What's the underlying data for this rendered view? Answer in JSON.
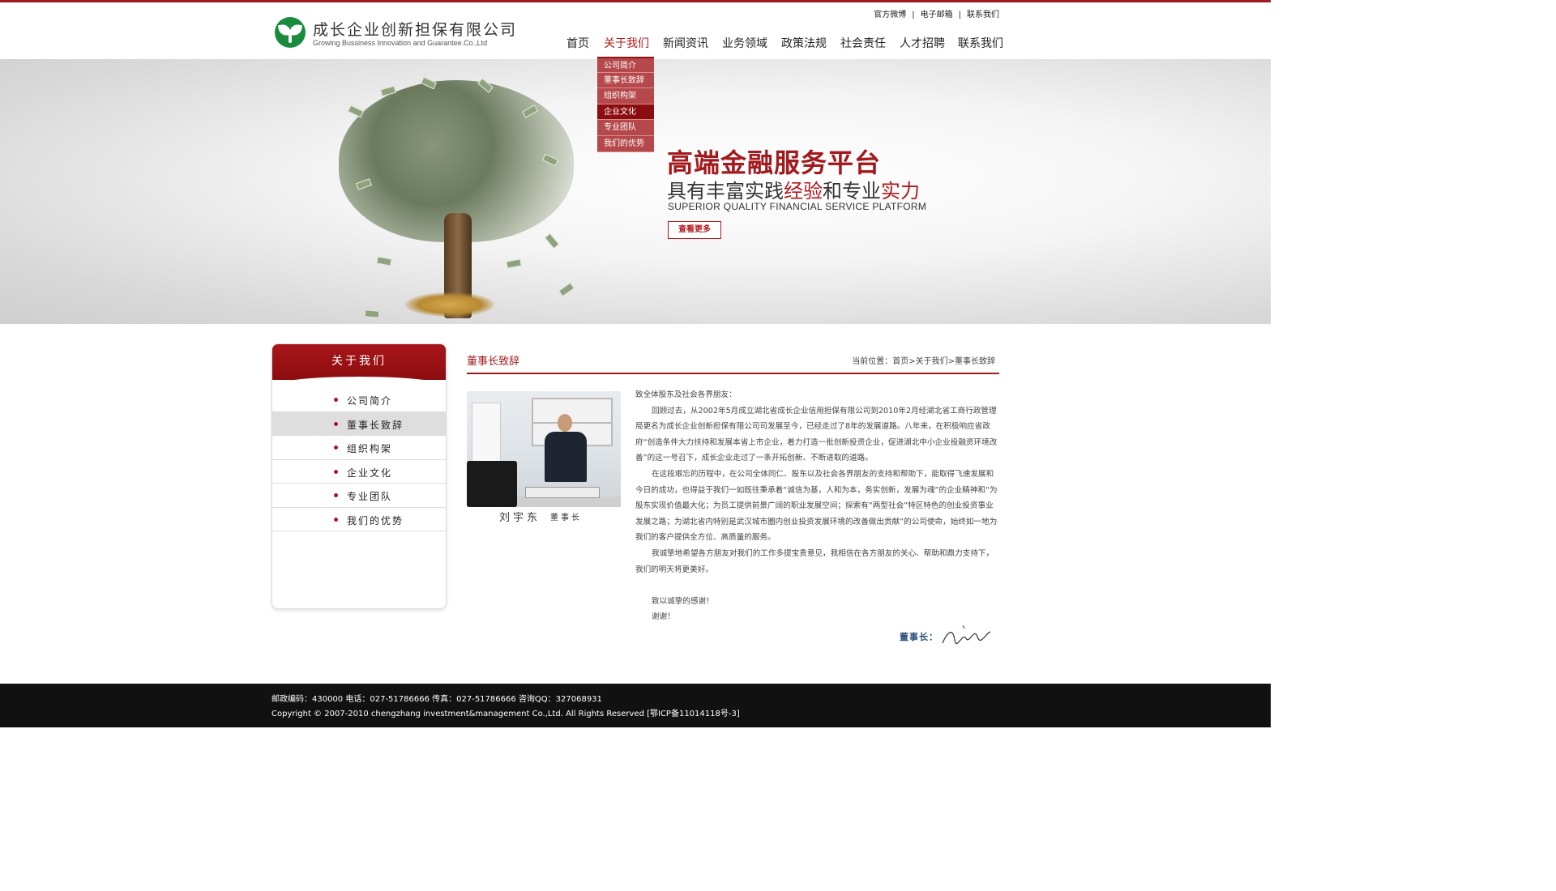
{
  "colors": {
    "accent": "#9b1b1e",
    "brand_green": "#1a8b3d",
    "footer_bg": "#111111"
  },
  "header": {
    "logo_cn": "成长企业创新担保有限公司",
    "logo_en": "Growing Bussiness Innovation and  Guarantee.Co.,Ltd",
    "logo_icon": "leaf-logo-icon",
    "top_links": [
      "官方微博",
      "电子邮箱",
      "联系我们"
    ],
    "nav": [
      "首页",
      "关于我们",
      "新闻资讯",
      "业务领域",
      "政策法规",
      "社会责任",
      "人才招聘",
      "联系我们"
    ],
    "nav_active": "关于我们",
    "submenu": [
      "公司简介",
      "董事长致辞",
      "组织构架",
      "企业文化",
      "专业团队",
      "我们的优势"
    ],
    "submenu_active": "企业文化"
  },
  "banner": {
    "title": "高端金融服务平台",
    "subtitle_parts": [
      "具有丰富实践",
      "经验",
      "和专业",
      "实力"
    ],
    "en": "SUPERIOR QUALITY FINANCIAL SERVICE PLATFORM",
    "button": "查看更多"
  },
  "sidebar": {
    "title": "关于我们",
    "items": [
      "公司简介",
      "董事长致辞",
      "组织构架",
      "企业文化",
      "专业团队",
      "我们的优势"
    ],
    "active": "董事长致辞"
  },
  "content": {
    "title": "董事长致辞",
    "breadcrumb": "当前位置：首页>关于我们>董事长致辞",
    "photo_caption_name": "刘宇东",
    "photo_caption_role": "董事长",
    "greeting": "致全体股东及社会各界朋友：",
    "paragraphs": [
      "回顾过去，从2002年5月成立湖北省成长企业信用担保有限公司到2010年2月经湖北省工商行政管理局更名为成长企业创新担保有限公司司发展至今，已经走过了8年的发展道路。八年来，在积极响应省政府“创造条件大力扶持和发展本省上市企业，着力打造一批创新投资企业，促进湖北中小企业投融资环境改善”的这一号召下，成长企业走过了一条开拓创新、不断进取的道路。",
      "在这段艰忘的历程中，在公司全体同仁、股东以及社会各界朋友的支持和帮助下，能取得飞速发展和今日的成功，也得益于我们一如既往秉承着“诚信为基，人和为本，务实创新，发展为魂”的企业精神和“为股东实现价值最大化；为员工提供前景广阔的职业发展空间；探索有“两型社会”特区特色的创业投资事业发展之路；为湖北省内特别是武汉城市圈内创业投资发展环境的改善做出贡献”的公司使命，始终如一地为我们的客户提供全方位、高质量的服务。",
      "我诚挚地希望各方朋友对我们的工作多提宝贵意见，我相信在各方朋友的关心、帮助和鼎力支持下，我们的明天将更美好。"
    ],
    "closing_1": "致以诚挚的感谢！",
    "closing_2": "谢谢！",
    "signature_label": "董事长："
  },
  "footer": {
    "line1": "邮政编码：430000 电话：027-51786666 传真：027-51786666 咨询QQ：327068931",
    "line2": "Copyright © 2007-2010 chengzhang investment&management Co.,Ltd. All Rights Reserved      [鄂ICP备11014118号-3]"
  }
}
